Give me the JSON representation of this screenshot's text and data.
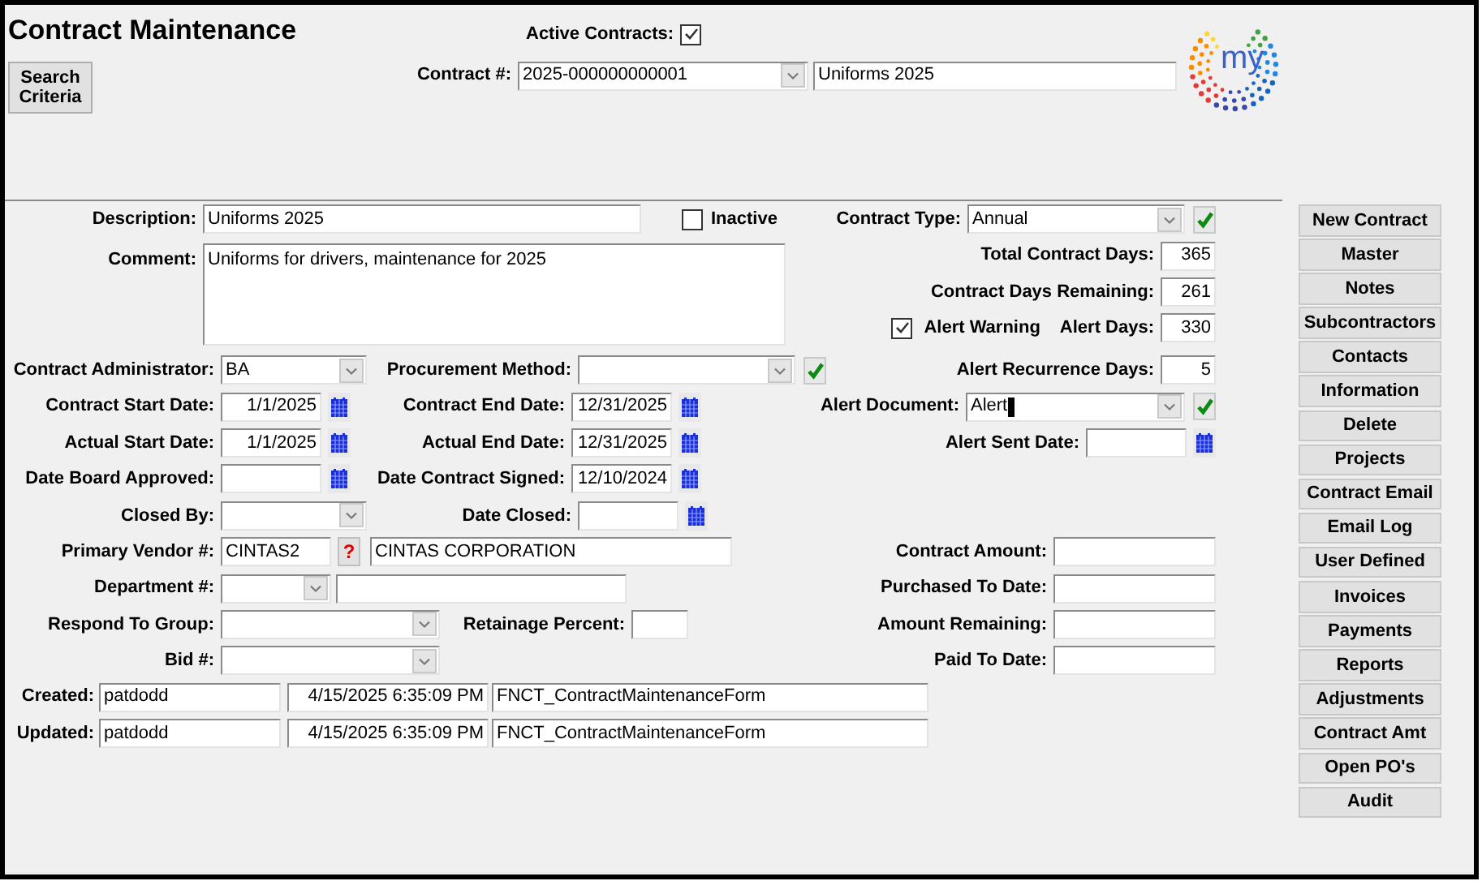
{
  "title": "Contract Maintenance",
  "search_button": "Search Criteria",
  "active_contracts": {
    "label": "Active Contracts:",
    "checked": true
  },
  "contract_number": {
    "label": "Contract #:",
    "value": "2025-000000000001",
    "name": "Uniforms 2025"
  },
  "logo_text": "my",
  "description": {
    "label": "Description:",
    "value": "Uniforms 2025"
  },
  "inactive": {
    "label": "Inactive",
    "checked": false
  },
  "contract_type": {
    "label": "Contract Type:",
    "value": "Annual"
  },
  "comment": {
    "label": "Comment:",
    "value": "Uniforms for drivers, maintenance for 2025"
  },
  "total_contract_days": {
    "label": "Total Contract Days:",
    "value": "365"
  },
  "contract_days_remaining": {
    "label": "Contract Days Remaining:",
    "value": "261"
  },
  "alert_warning": {
    "label": "Alert Warning",
    "checked": true
  },
  "alert_days": {
    "label": "Alert Days:",
    "value": "330"
  },
  "contract_administrator": {
    "label": "Contract Administrator:",
    "value": "BA"
  },
  "procurement_method": {
    "label": "Procurement Method:"
  },
  "alert_recurrence_days": {
    "label": "Alert Recurrence Days:",
    "value": "5"
  },
  "contract_start_date": {
    "label": "Contract Start Date:",
    "value": "1/1/2025"
  },
  "contract_end_date": {
    "label": "Contract End Date:",
    "value": "12/31/2025"
  },
  "alert_document": {
    "label": "Alert Document:",
    "value": "Alert"
  },
  "actual_start_date": {
    "label": "Actual Start Date:",
    "value": "1/1/2025"
  },
  "actual_end_date": {
    "label": "Actual End Date:",
    "value": "12/31/2025"
  },
  "alert_sent_date": {
    "label": "Alert Sent Date:"
  },
  "date_board_approved": {
    "label": "Date Board Approved:"
  },
  "date_contract_signed": {
    "label": "Date Contract Signed:",
    "value": "12/10/2024"
  },
  "closed_by": {
    "label": "Closed By:"
  },
  "date_closed": {
    "label": "Date Closed:"
  },
  "primary_vendor": {
    "label": "Primary Vendor #:",
    "value": "CINTAS2",
    "help": "?",
    "name": "CINTAS CORPORATION"
  },
  "contract_amount": {
    "label": "Contract Amount:"
  },
  "department": {
    "label": "Department #:"
  },
  "purchased_to_date": {
    "label": "Purchased To Date:"
  },
  "respond_to_group": {
    "label": "Respond To Group:"
  },
  "retainage_percent": {
    "label": "Retainage Percent:"
  },
  "amount_remaining": {
    "label": "Amount Remaining:"
  },
  "bid": {
    "label": "Bid #:"
  },
  "paid_to_date": {
    "label": "Paid To Date:"
  },
  "created": {
    "label": "Created:",
    "user": "patdodd",
    "timestamp": "4/15/2025 6:35:09 PM",
    "form": "FNCT_ContractMaintenanceForm"
  },
  "updated": {
    "label": "Updated:",
    "user": "patdodd",
    "timestamp": "4/15/2025 6:35:09 PM",
    "form": "FNCT_ContractMaintenanceForm"
  },
  "buttons": [
    "New Contract",
    "Master",
    "Notes",
    "Subcontractors",
    "Contacts",
    "Information",
    "Delete",
    "Projects",
    "Contract Email",
    "Email Log",
    "User Defined",
    "Invoices",
    "Payments",
    "Reports",
    "Adjustments",
    "Contract Amt",
    "Open PO's",
    "Audit"
  ]
}
